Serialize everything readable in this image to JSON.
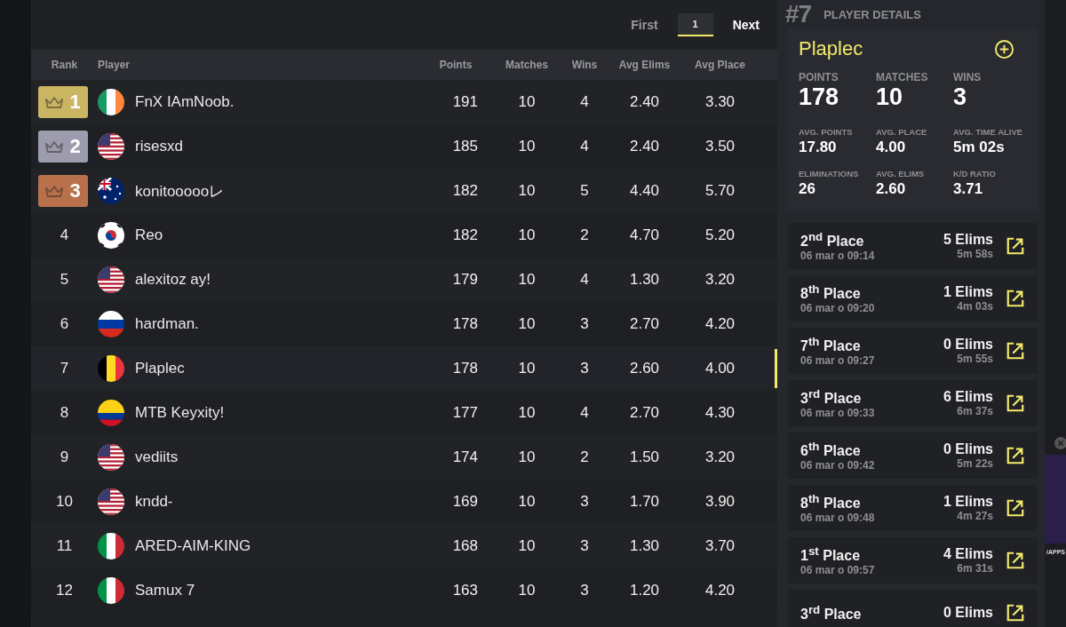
{
  "pagination": {
    "first": "First",
    "current": "1",
    "next": "Next"
  },
  "table": {
    "columns": [
      "Rank",
      "Player",
      "Points",
      "Matches",
      "Wins",
      "Avg Elims",
      "Avg Place"
    ],
    "rows": [
      {
        "rank": "1",
        "player": "FnX IAmNoob.",
        "flag": {
          "kind": "ie"
        },
        "points": "191",
        "matches": "10",
        "wins": "4",
        "avg_elims": "2.40",
        "avg_place": "3.30",
        "kind": "podium",
        "color": "#c9b562",
        "selected": false
      },
      {
        "rank": "2",
        "player": "risesxd",
        "flag": {
          "kind": "us"
        },
        "points": "185",
        "matches": "10",
        "wins": "4",
        "avg_elims": "2.40",
        "avg_place": "3.50",
        "kind": "podium",
        "color": "#9c9cae",
        "selected": false
      },
      {
        "rank": "3",
        "player": "konitoooooレ",
        "flag": {
          "kind": "au"
        },
        "points": "182",
        "matches": "10",
        "wins": "5",
        "avg_elims": "4.40",
        "avg_place": "5.70",
        "kind": "podium",
        "color": "#b8714b",
        "selected": false
      },
      {
        "rank": "4",
        "player": "Reo",
        "flag": {
          "kind": "kr"
        },
        "points": "182",
        "matches": "10",
        "wins": "2",
        "avg_elims": "4.70",
        "avg_place": "5.20",
        "kind": "plain",
        "selected": false
      },
      {
        "rank": "5",
        "player": "alexitoz ay!",
        "flag": {
          "kind": "us"
        },
        "points": "179",
        "matches": "10",
        "wins": "4",
        "avg_elims": "1.30",
        "avg_place": "3.20",
        "kind": "plain",
        "selected": false
      },
      {
        "rank": "6",
        "player": "hardman.",
        "flag": {
          "kind": "ru"
        },
        "points": "178",
        "matches": "10",
        "wins": "3",
        "avg_elims": "2.70",
        "avg_place": "4.20",
        "kind": "plain",
        "selected": false
      },
      {
        "rank": "7",
        "player": "Plaplec",
        "flag": {
          "kind": "be"
        },
        "points": "178",
        "matches": "10",
        "wins": "3",
        "avg_elims": "2.60",
        "avg_place": "4.00",
        "kind": "plain",
        "selected": true
      },
      {
        "rank": "8",
        "player": "MTB Keyxity!",
        "flag": {
          "kind": "co"
        },
        "points": "177",
        "matches": "10",
        "wins": "4",
        "avg_elims": "2.70",
        "avg_place": "4.30",
        "kind": "plain",
        "selected": false
      },
      {
        "rank": "9",
        "player": "vediits",
        "flag": {
          "kind": "us"
        },
        "points": "174",
        "matches": "10",
        "wins": "2",
        "avg_elims": "1.50",
        "avg_place": "3.20",
        "kind": "plain",
        "selected": false
      },
      {
        "rank": "10",
        "player": "kndd-",
        "flag": {
          "kind": "us"
        },
        "points": "169",
        "matches": "10",
        "wins": "3",
        "avg_elims": "1.70",
        "avg_place": "3.90",
        "kind": "plain",
        "selected": false
      },
      {
        "rank": "11",
        "player": "ARED-AIM-KING",
        "flag": {
          "kind": "it"
        },
        "points": "168",
        "matches": "10",
        "wins": "3",
        "avg_elims": "1.30",
        "avg_place": "3.70",
        "kind": "plain",
        "selected": false
      },
      {
        "rank": "12",
        "player": "Samux 7",
        "flag": {
          "kind": "it"
        },
        "points": "163",
        "matches": "10",
        "wins": "3",
        "avg_elims": "1.20",
        "avg_place": "4.20",
        "kind": "plain",
        "selected": false
      }
    ]
  },
  "details": {
    "rank": "#7",
    "heading": "PLAYER DETAILS",
    "player": "Plaplec",
    "main_stats": [
      {
        "label": "POINTS",
        "value": "178"
      },
      {
        "label": "MATCHES",
        "value": "10"
      },
      {
        "label": "WINS",
        "value": "3"
      }
    ],
    "stats": [
      {
        "label": "AVG. POINTS",
        "value": "17.80"
      },
      {
        "label": "AVG. PLACE",
        "value": "4.00"
      },
      {
        "label": "AVG. TIME ALIVE",
        "value": "5m 02s"
      },
      {
        "label": "ELIMINATIONS",
        "value": "26"
      },
      {
        "label": "AVG. ELIMS",
        "value": "2.60"
      },
      {
        "label": "K/D RATIO",
        "value": "3.71"
      }
    ],
    "matches": [
      {
        "place": "2$^{nd}$ Place",
        "date": "06 mar o 09:14",
        "elims": "5 Elims",
        "time": "5m 58s"
      },
      {
        "place": "8$^{th}$ Place",
        "date": "06 mar o 09:20",
        "elims": "1 Elims",
        "time": "4m 03s"
      },
      {
        "place": "7$^{th}$ Place",
        "date": "06 mar o 09:27",
        "elims": "0 Elims",
        "time": "5m 55s"
      },
      {
        "place": "3$^{rd}$ Place",
        "date": "06 mar o 09:33",
        "elims": "6 Elims",
        "time": "6m 37s"
      },
      {
        "place": "6$^{th}$ Place",
        "date": "06 mar o 09:42",
        "elims": "0 Elims",
        "time": "5m 22s"
      },
      {
        "place": "8$^{th}$ Place",
        "date": "06 mar o 09:48",
        "elims": "1 Elims",
        "time": "4m 27s"
      },
      {
        "place": "1$^{st}$ Place",
        "date": "06 mar o 09:57",
        "elims": "4 Elims",
        "time": "6m 31s"
      },
      {
        "place": "3$^{rd}$ Place",
        "elims": "0 Elims"
      }
    ]
  },
  "ad": {
    "text": "/APPS"
  }
}
